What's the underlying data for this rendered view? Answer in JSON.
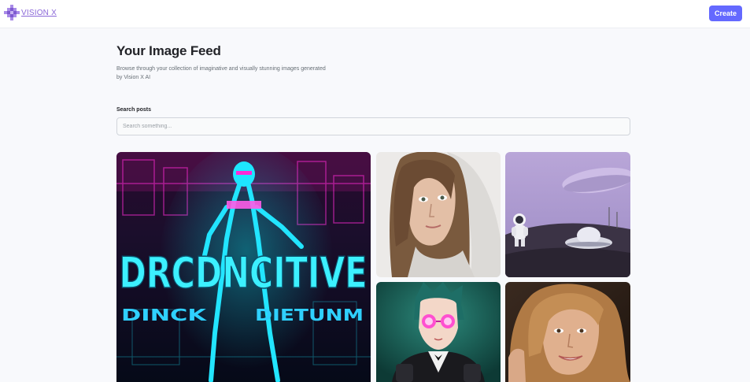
{
  "header": {
    "logo_text": "VISION X",
    "create_label": "Create"
  },
  "main": {
    "title": "Your Image Feed",
    "subtitle": "Browse through your collection of imaginative and visually stunning images generated by Vision X AI"
  },
  "search": {
    "label": "Search posts",
    "placeholder": "Search something...",
    "value": ""
  },
  "posts": [
    {
      "subject": "neon cyberpunk android poster",
      "overlay_text_1": "DRCDNCITIVE",
      "overlay_text_2": "DINCK",
      "overlay_text_3": "DIETUNM"
    },
    {
      "subject": "portrait of young woman in white hood"
    },
    {
      "subject": "astronaut and flying saucer on purple planet"
    },
    {
      "subject": "anime boy with pink glasses in suit"
    },
    {
      "subject": "portrait of smiling woman with wavy hair"
    }
  ],
  "colors": {
    "primary": "#6469ff",
    "background": "#f8f9fc",
    "logo": "#8a67d8"
  }
}
